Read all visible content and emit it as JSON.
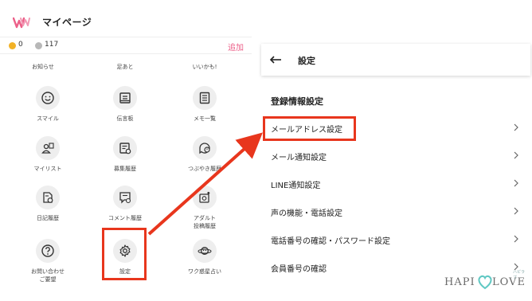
{
  "left": {
    "title": "マイページ",
    "coins": {
      "a": "0",
      "b": "117"
    },
    "add_link": "追加",
    "top_labels": [
      "お知らせ",
      "足あと",
      "いいかも!"
    ],
    "items": [
      {
        "label": "スマイル",
        "icon": "smile-icon"
      },
      {
        "label": "伝言板",
        "icon": "board-icon"
      },
      {
        "label": "メモ一覧",
        "icon": "memo-icon"
      },
      {
        "label": "マイリスト",
        "icon": "mylist-icon"
      },
      {
        "label": "募集履歴",
        "icon": "recruit-icon"
      },
      {
        "label": "つぶやき履歴",
        "icon": "tweet-history-icon"
      },
      {
        "label": "日記履歴",
        "icon": "diary-icon"
      },
      {
        "label": "コメント履歴",
        "icon": "comment-icon"
      },
      {
        "label": "アダルト\n投稿履歴",
        "icon": "adult-post-icon"
      },
      {
        "label": "お問い合わせ\nご要望",
        "icon": "help-icon"
      },
      {
        "label": "設定",
        "icon": "gear-icon"
      },
      {
        "label": "ワク惑星占い",
        "icon": "planet-icon"
      }
    ]
  },
  "right": {
    "title": "設定",
    "section": "登録情報設定",
    "rows": [
      "メールアドレス設定",
      "メール通知設定",
      "LINE通知設定",
      "声の機能・電話設定",
      "電話番号の確認・パスワード設定",
      "会員番号の確認"
    ]
  },
  "brand": {
    "left": "HAPI",
    "right": "LOVE",
    "ruby": "ハピラブ"
  },
  "colors": {
    "accent": "#e8361d",
    "pink": "#ec5f88",
    "coin_gold": "#f2b227"
  }
}
